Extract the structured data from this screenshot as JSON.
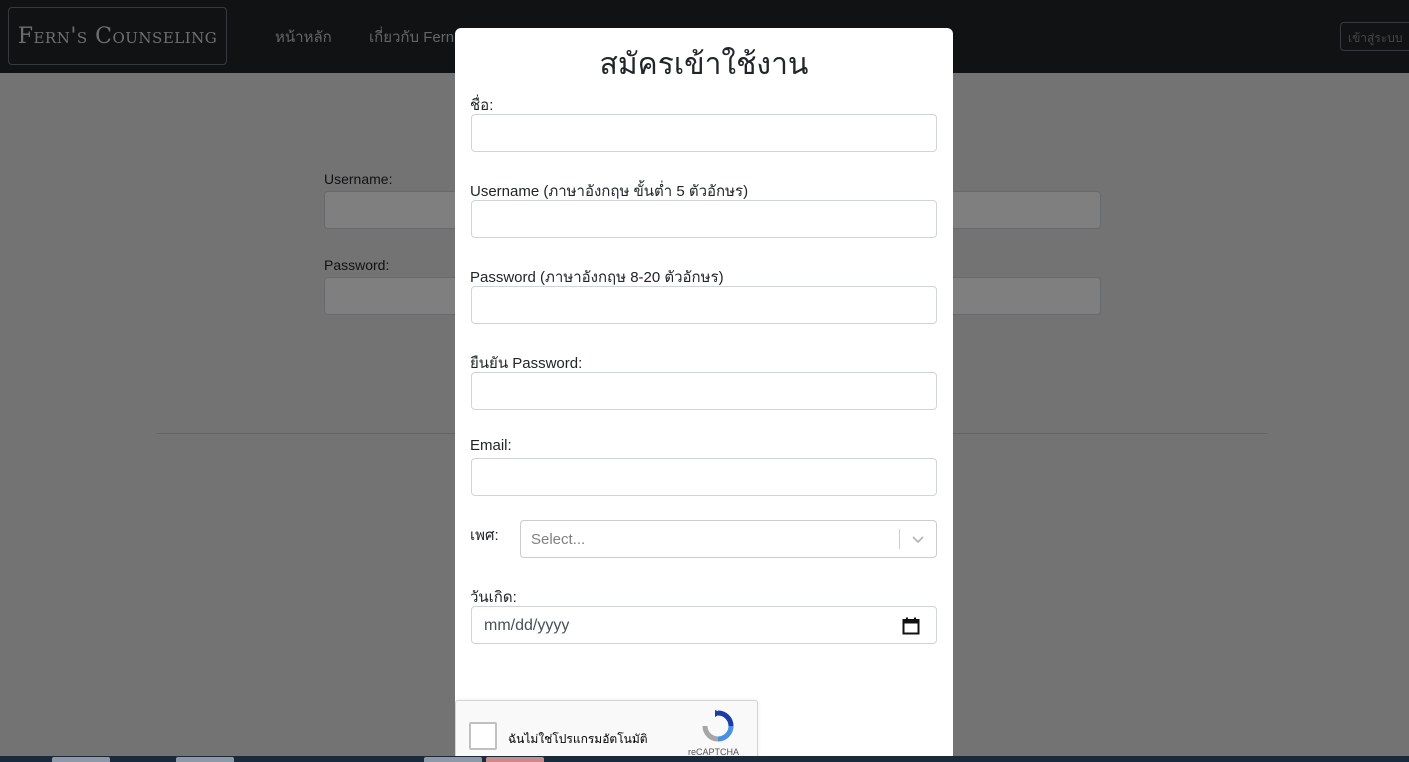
{
  "navbar": {
    "brand": "Fern's Counseling",
    "links": [
      "หน้าหลัก",
      "เกี่ยวกับ Fern"
    ],
    "login_button": "เข้าสู่ระบบ"
  },
  "background_form": {
    "username_label": "Username:",
    "password_label": "Password:"
  },
  "modal": {
    "title": "สมัครเข้าใช้งาน",
    "fields": {
      "name_label": "ชื่อ:",
      "username_label": "Username (ภาษาอังกฤษ ขั้นต่ำ 5 ตัวอักษร)",
      "password_label": "Password (ภาษาอังกฤษ 8-20 ตัวอักษร)",
      "confirm_password_label": "ยืนยัน Password:",
      "email_label": "Email:",
      "gender_label": "เพศ:",
      "gender_placeholder": "Select...",
      "birthdate_label": "วันเกิด:",
      "birthdate_placeholder": "mm/dd/yyyy"
    },
    "recaptcha": {
      "label": "ฉันไม่ใช่โปรแกรมอัตโนมัติ",
      "brand": "reCAPTCHA"
    }
  },
  "icons": {
    "dropdown": "chevron-down-icon",
    "calendar": "calendar-icon",
    "recaptcha": "recaptcha-logo-icon"
  },
  "colors": {
    "navbar_bg": "#212529",
    "overlay": "rgba(0,0,0,0.5)",
    "modal_bg": "#ffffff",
    "input_border": "#ced4da"
  }
}
